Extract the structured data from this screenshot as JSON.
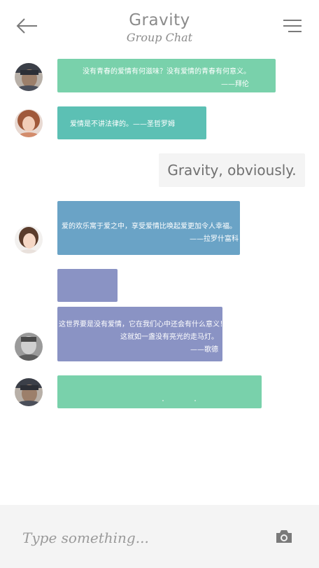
{
  "header": {
    "title": "Gravity",
    "subtitle": "Group Chat",
    "back_icon": "arrow-left-icon",
    "menu_icon": "hamburger-menu-icon"
  },
  "messages": [
    {
      "sender": "avatar-man-1",
      "color": "#79d1ab",
      "lines": [
        "没有青春的爱情有何滋味？没有爱情的青春有何意义。",
        "——拜伦"
      ]
    },
    {
      "sender": "avatar-woman-1",
      "color": "#5cc0b4",
      "lines": [
        "爱情是不讲法律的。——圣哲罗姆"
      ]
    },
    {
      "sender": "self",
      "color": "#f4f4f4",
      "lines": [
        "Gravity, obviously."
      ]
    },
    {
      "sender": "avatar-woman-2",
      "color": "#6aa3c6",
      "lines": [
        "爱的欢乐寓于爱之中，享受爱情比唤起爱更加令人幸福。",
        "——拉罗什富科"
      ]
    },
    {
      "sender": "avatar-woman-2",
      "color": "#8a93c4",
      "lines": []
    },
    {
      "sender": "avatar-man-2",
      "color": "#8a93c4",
      "lines": [
        "这世界要是没有爱情，它在我们心中还会有什么意义！",
        "这就如一盏没有亮光的走马灯。",
        "——歌德"
      ]
    },
    {
      "sender": "avatar-man-1",
      "color": "#79d1ab",
      "lines": []
    }
  ],
  "input": {
    "placeholder": "Type something...",
    "camera_icon": "camera-icon"
  },
  "colors": {
    "green": "#79d1ab",
    "teal": "#5cc0b4",
    "blue": "#6aa3c6",
    "purple": "#8a93c4",
    "input_bar": "#f4f4f4",
    "text_gray": "#8b8b8b"
  }
}
